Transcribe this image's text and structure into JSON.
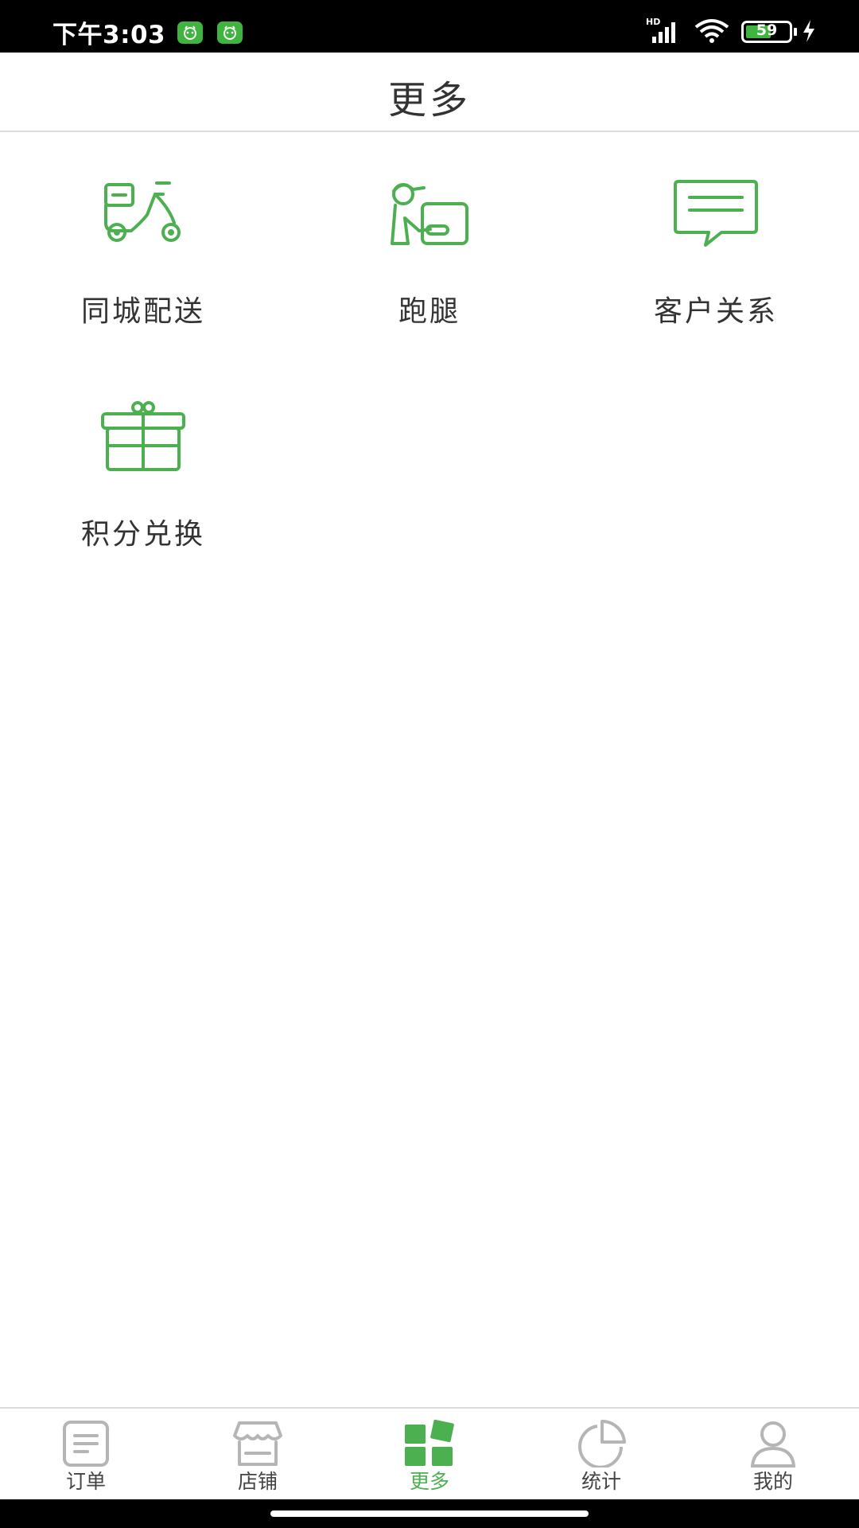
{
  "status_bar": {
    "time": "下午3:03",
    "network_label": "HD",
    "battery_level": "59",
    "battery_fraction": 0.59,
    "icons": [
      "notification-app-icon",
      "notification-app-icon",
      "signal-icon",
      "wifi-icon",
      "battery-icon",
      "charging-icon"
    ]
  },
  "header": {
    "title": "更多"
  },
  "features": [
    {
      "label": "同城配送",
      "icon": "scooter-icon"
    },
    {
      "label": "跑腿",
      "icon": "courier-icon"
    },
    {
      "label": "客户关系",
      "icon": "chat-icon"
    },
    {
      "label": "积分兑换",
      "icon": "gift-icon"
    }
  ],
  "tabs": [
    {
      "label": "订单",
      "icon": "order-icon",
      "active": false
    },
    {
      "label": "店铺",
      "icon": "store-icon",
      "active": false
    },
    {
      "label": "更多",
      "icon": "more-grid-icon",
      "active": true
    },
    {
      "label": "统计",
      "icon": "pie-chart-icon",
      "active": false
    },
    {
      "label": "我的",
      "icon": "user-icon",
      "active": false
    }
  ],
  "colors": {
    "accent": "#4caf50",
    "inactive_icon": "#b5b5b5",
    "text": "#333333"
  }
}
